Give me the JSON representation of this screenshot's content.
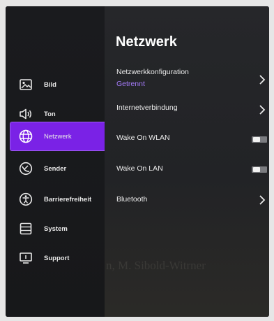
{
  "sidebar": {
    "items": [
      {
        "label": "Bild",
        "icon": "picture-icon"
      },
      {
        "label": "Ton",
        "icon": "speaker-icon"
      },
      {
        "label": "Netzwerk",
        "icon": "globe-icon",
        "active": true
      },
      {
        "label": "Sender",
        "icon": "satellite-dish-icon"
      },
      {
        "label": "Barrierefreiheit",
        "icon": "accessibility-icon"
      },
      {
        "label": "System",
        "icon": "system-icon"
      },
      {
        "label": "Support",
        "icon": "support-icon"
      }
    ]
  },
  "panel": {
    "title": "Netzwerk",
    "rows": [
      {
        "label": "Netzwerkkonfiguration",
        "sub": "Getrennt",
        "control": "chevron"
      },
      {
        "label": "Internetverbindung",
        "control": "chevron"
      },
      {
        "label": "Wake On WLAN",
        "control": "toggle"
      },
      {
        "label": "Wake On LAN",
        "control": "toggle"
      },
      {
        "label": "Bluetooth",
        "control": "chevron"
      }
    ],
    "background_text": "n, M. Sibold-Witrner"
  },
  "colors": {
    "accent": "#7a22e6",
    "status": "#a37af7",
    "background": "#111214"
  }
}
